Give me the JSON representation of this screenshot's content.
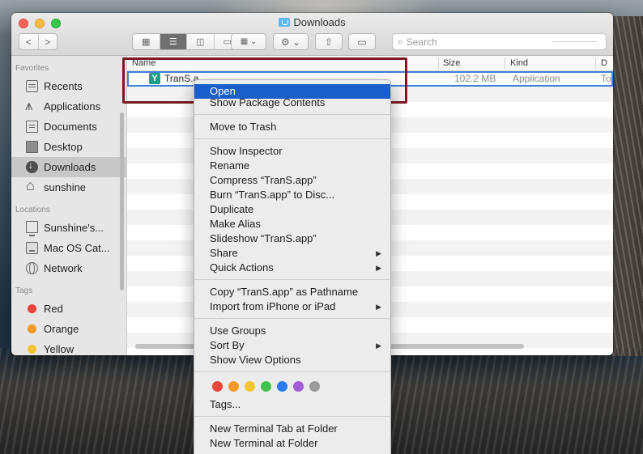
{
  "window": {
    "title": "Downloads"
  },
  "toolbar": {
    "back": "<",
    "forward": ">",
    "search_placeholder": "Search"
  },
  "sidebar": {
    "favorites_label": "Favorites",
    "favorites": [
      {
        "label": "Recents",
        "icon": "recents-icon"
      },
      {
        "label": "Applications",
        "icon": "applications-icon"
      },
      {
        "label": "Documents",
        "icon": "documents-icon"
      },
      {
        "label": "Desktop",
        "icon": "desktop-icon"
      },
      {
        "label": "Downloads",
        "icon": "downloads-icon",
        "selected": true
      },
      {
        "label": "sunshine",
        "icon": "home-icon"
      }
    ],
    "locations_label": "Locations",
    "locations": [
      {
        "label": "Sunshine's...",
        "icon": "computer-icon"
      },
      {
        "label": "Mac OS Cat...",
        "icon": "disk-icon"
      },
      {
        "label": "Network",
        "icon": "network-icon"
      }
    ],
    "tags_label": "Tags",
    "tags": [
      {
        "label": "Red",
        "color": "#e8453c"
      },
      {
        "label": "Orange",
        "color": "#f39a27"
      },
      {
        "label": "Yellow",
        "color": "#f5c531"
      }
    ]
  },
  "list": {
    "columns": {
      "name": "Name",
      "size": "Size",
      "kind": "Kind",
      "date": "D"
    },
    "selected_row": {
      "name": "TranS.a",
      "size": "102.2 MB",
      "kind": "Application",
      "date": "To"
    }
  },
  "context_menu": {
    "open": "Open",
    "show_package_contents": "Show Package Contents",
    "move_to_trash": "Move to Trash",
    "show_inspector": "Show Inspector",
    "rename": "Rename",
    "compress": "Compress “TranS.app”",
    "burn": "Burn “TranS.app” to Disc...",
    "duplicate": "Duplicate",
    "make_alias": "Make Alias",
    "slideshow": "Slideshow “TranS.app”",
    "share": "Share",
    "quick_actions": "Quick Actions",
    "copy_pathname": "Copy “TranS.app” as Pathname",
    "import_iphone": "Import from iPhone or iPad",
    "use_groups": "Use Groups",
    "sort_by": "Sort By",
    "show_view_options": "Show View Options",
    "tag_colors": [
      "#e8453c",
      "#f39a27",
      "#f5c531",
      "#3fc24d",
      "#2b7cf0",
      "#a15bd6",
      "#9a9a9a"
    ],
    "tags": "Tags...",
    "new_terminal_tab": "New Terminal Tab at Folder",
    "new_terminal": "New Terminal at Folder"
  }
}
